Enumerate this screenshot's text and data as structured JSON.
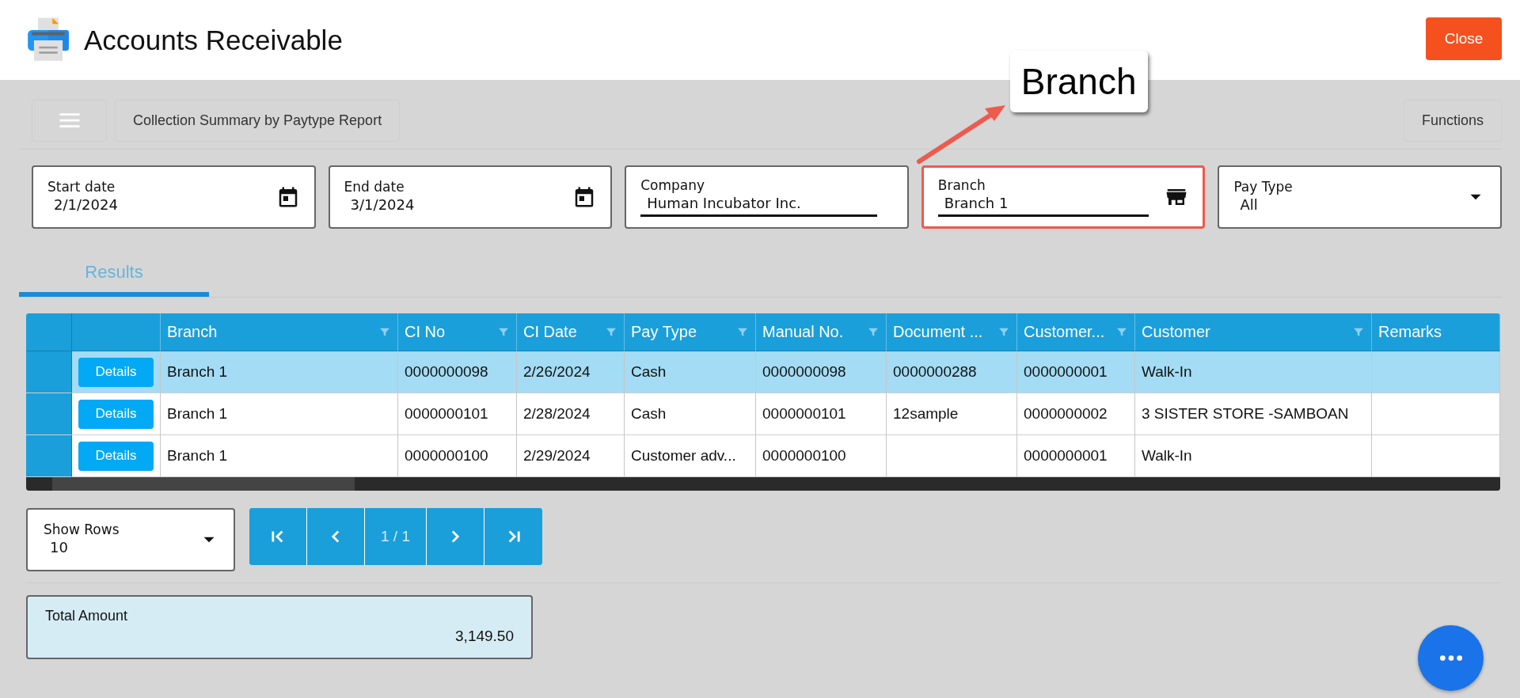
{
  "header": {
    "title": "Accounts Receivable",
    "close_button": "Close"
  },
  "toolbar": {
    "report_title": "Collection Summary by Paytype Report",
    "functions_button": "Functions"
  },
  "filters": [
    {
      "kind": "date",
      "label": "Start date",
      "value": "2/1/2024",
      "highlighted": false
    },
    {
      "kind": "date",
      "label": "End date",
      "value": "3/1/2024",
      "highlighted": false
    },
    {
      "kind": "text",
      "label": "Company",
      "value": "Human Incubator Inc.",
      "highlighted": false
    },
    {
      "kind": "lookup",
      "label": "Branch",
      "value": "Branch 1",
      "highlighted": true
    },
    {
      "kind": "select",
      "label": "Pay Type",
      "value": "All",
      "highlighted": false
    }
  ],
  "annotation": {
    "text": "Branch"
  },
  "tabs": [
    {
      "label": "Results",
      "selected": true
    }
  ],
  "table": {
    "columns": [
      {
        "label": "Branch",
        "filter": true
      },
      {
        "label": "CI No",
        "filter": true
      },
      {
        "label": "CI Date",
        "filter": true
      },
      {
        "label": "Pay Type",
        "filter": true
      },
      {
        "label": "Manual No.",
        "filter": true
      },
      {
        "label": "Document ...",
        "filter": true
      },
      {
        "label": "Customer...",
        "filter": true
      },
      {
        "label": "Customer",
        "filter": true
      },
      {
        "label": "Remarks",
        "filter": false
      }
    ],
    "rows": [
      {
        "selected": true,
        "action": "Details",
        "cells": [
          "Branch 1",
          "0000000098",
          "2/26/2024",
          "Cash",
          "0000000098",
          "0000000288",
          "0000000001",
          "Walk-In",
          ""
        ]
      },
      {
        "selected": false,
        "action": "Details",
        "cells": [
          "Branch 1",
          "0000000101",
          "2/28/2024",
          "Cash",
          "0000000101",
          "12sample",
          "0000000002",
          "3 SISTER STORE -SAMBOAN",
          ""
        ]
      },
      {
        "selected": false,
        "action": "Details",
        "cells": [
          "Branch 1",
          "0000000100",
          "2/29/2024",
          "Customer adv...",
          "0000000100",
          "",
          "0000000001",
          "Walk-In",
          ""
        ]
      }
    ]
  },
  "show_rows": {
    "label": "Show Rows",
    "value": "10"
  },
  "pager": {
    "page": "1 / 1"
  },
  "total": {
    "label": "Total Amount",
    "value": "3,149.50"
  }
}
